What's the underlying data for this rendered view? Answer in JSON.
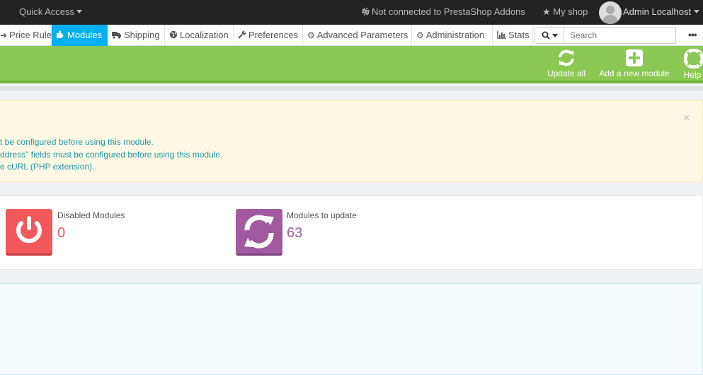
{
  "topbar": {
    "quick_access": "Quick Access",
    "addons_status": "Not connected to PrestaShop Addons",
    "my_shop": "My shop",
    "user_name": "Admin Localhost"
  },
  "nav": {
    "items": [
      {
        "label": "Price Rules",
        "icon": "price-rules-icon"
      },
      {
        "label": "Modules",
        "icon": "puzzle-icon"
      },
      {
        "label": "Shipping",
        "icon": "truck-icon"
      },
      {
        "label": "Localization",
        "icon": "globe-icon"
      },
      {
        "label": "Preferences",
        "icon": "wrench-icon"
      },
      {
        "label": "Advanced Parameters",
        "icon": "cogs-icon"
      },
      {
        "label": "Administration",
        "icon": "gear-icon"
      },
      {
        "label": "Stats",
        "icon": "bar-chart-icon"
      }
    ],
    "active": "Modules",
    "search_placeholder": "Search",
    "more": "•••"
  },
  "toolbar": {
    "update_all": "Update all",
    "add_module": "Add a new module",
    "help": "Help"
  },
  "warning": {
    "close": "×",
    "lines": [
      "t be configured before using this module.",
      "ddress\" fields must be configured before using this module.",
      "e cURL (PHP extension)"
    ]
  },
  "kpis": [
    {
      "title": "Disabled Modules",
      "value": "0",
      "color": "#f1585c",
      "icon": "power-icon"
    },
    {
      "title": "Modules to update",
      "value": "63",
      "color": "#a2599f",
      "icon": "refresh-icon"
    }
  ],
  "colors": {
    "toolbar_green": "#8bc954",
    "nav_active": "#00aff0",
    "warning_bg": "#fcf8e3",
    "link_blue": "#1e94ab"
  }
}
